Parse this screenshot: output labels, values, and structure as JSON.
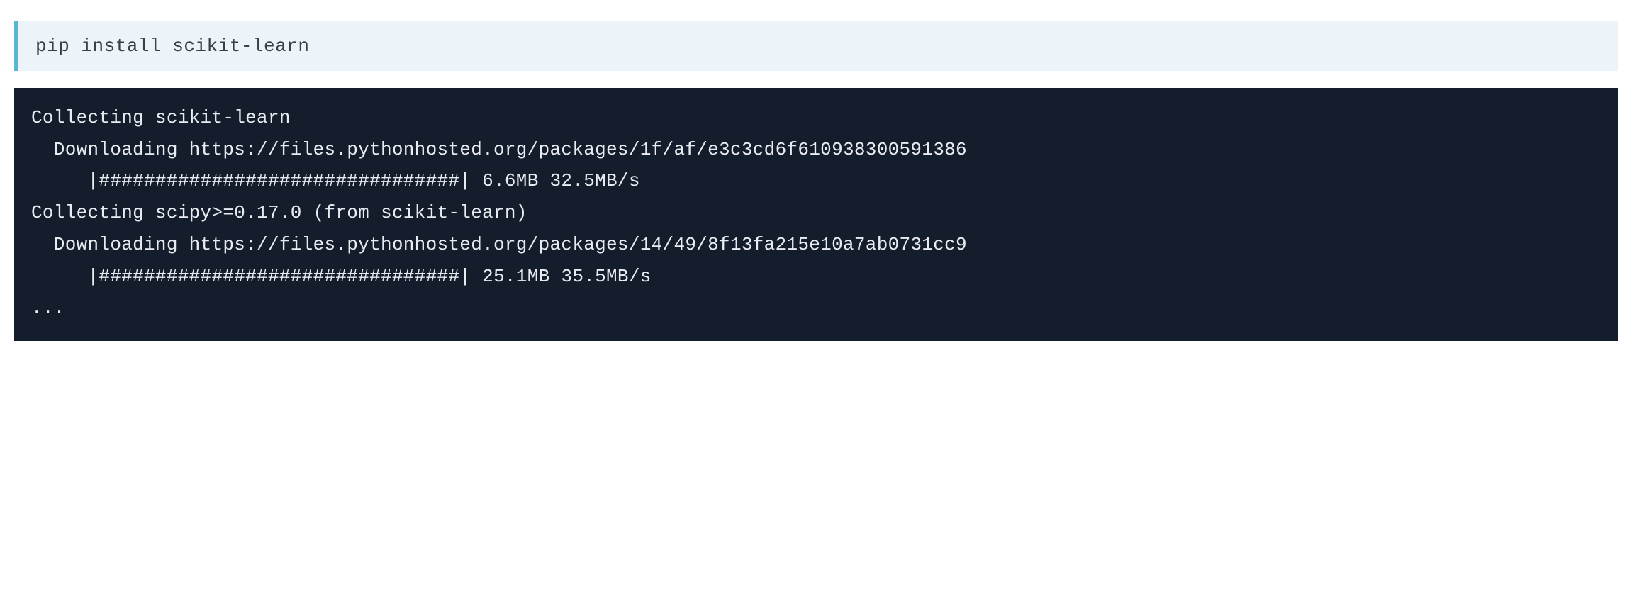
{
  "input": {
    "command": "pip install scikit-learn"
  },
  "output": {
    "lines": [
      "Collecting scikit-learn",
      "  Downloading https://files.pythonhosted.org/packages/1f/af/e3c3cd6f610938300591386",
      "     |################################| 6.6MB 32.5MB/s",
      "Collecting scipy>=0.17.0 (from scikit-learn)",
      "  Downloading https://files.pythonhosted.org/packages/14/49/8f13fa215e10a7ab0731cc9",
      "     |################################| 25.1MB 35.5MB/s",
      "..."
    ]
  }
}
